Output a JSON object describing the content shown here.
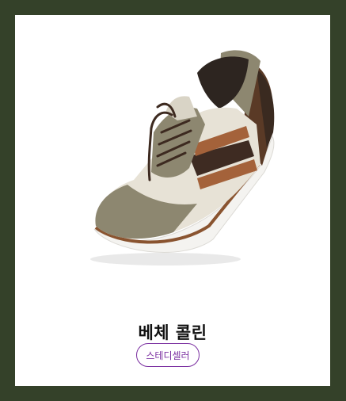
{
  "product": {
    "title": "베체 콜린",
    "badge": "스테디셀러",
    "image_icon": "sneaker-product-image"
  },
  "colors": {
    "frame": "#344129",
    "badge_accent": "#7a2ea0"
  }
}
